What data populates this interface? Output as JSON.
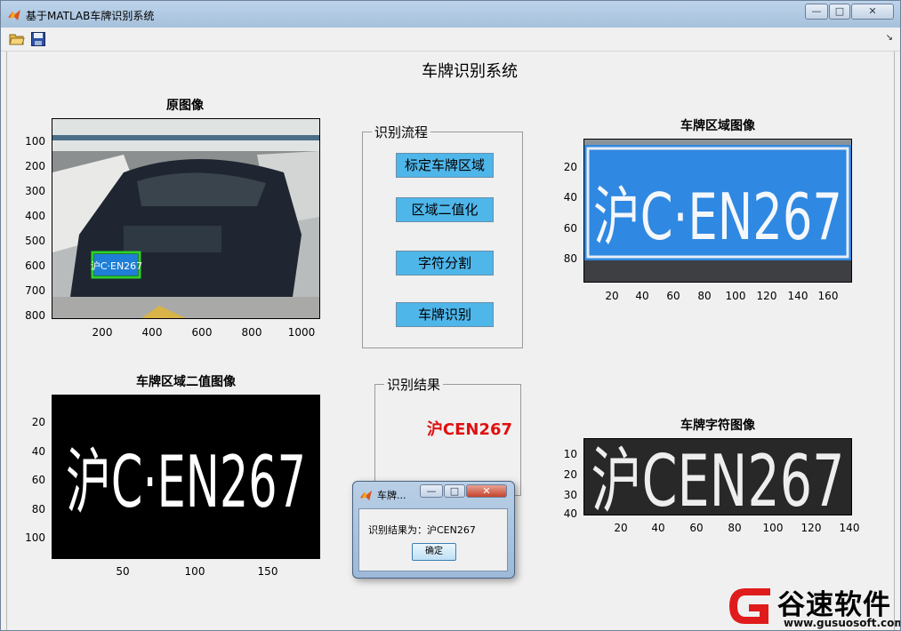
{
  "window": {
    "title": "基于MATLAB车牌识别系统",
    "minimize": "—",
    "maximize": "□",
    "close": "✕"
  },
  "toolbar": {
    "open_icon": "folder-open-icon",
    "save_icon": "save-disk-icon",
    "expand_glyph": "↘"
  },
  "app": {
    "title": "车牌识别系统"
  },
  "axes": {
    "original": {
      "title": "原图像",
      "yticks": [
        "100",
        "200",
        "300",
        "400",
        "500",
        "600",
        "700",
        "800"
      ],
      "xticks": [
        "200",
        "400",
        "600",
        "800",
        "1000"
      ],
      "plate_text": "沪C·EN267"
    },
    "plate": {
      "title": "车牌区域图像",
      "yticks": [
        "20",
        "40",
        "60",
        "80"
      ],
      "xticks": [
        "20",
        "40",
        "60",
        "80",
        "100",
        "120",
        "140",
        "160"
      ],
      "plate_text": "沪C·EN267"
    },
    "binary": {
      "title": "车牌区域二值图像",
      "yticks": [
        "20",
        "40",
        "60",
        "80",
        "100"
      ],
      "xticks": [
        "50",
        "100",
        "150"
      ],
      "plate_text": "沪C·EN267"
    },
    "chars": {
      "title": "车牌字符图像",
      "yticks": [
        "10",
        "20",
        "30",
        "40"
      ],
      "xticks": [
        "20",
        "40",
        "60",
        "80",
        "100",
        "120",
        "140"
      ],
      "plate_text": "沪CEN267"
    }
  },
  "process_panel": {
    "title": "识别流程",
    "buttons": [
      "标定车牌区域",
      "区域二值化",
      "字符分割",
      "车牌识别"
    ]
  },
  "result_panel": {
    "title": "识别结果",
    "value": "沪CEN267"
  },
  "dialog": {
    "title": "车牌...",
    "message": "识别结果为：沪CEN267",
    "ok": "确定"
  },
  "watermark": {
    "brand": "谷速软件",
    "url": "www.gusuosoft.com"
  },
  "colors": {
    "button_bg": "#4fb6ea",
    "result_red": "#e01010",
    "plate_blue": "#1f7fd6",
    "plate_box": "#2ad12a"
  }
}
